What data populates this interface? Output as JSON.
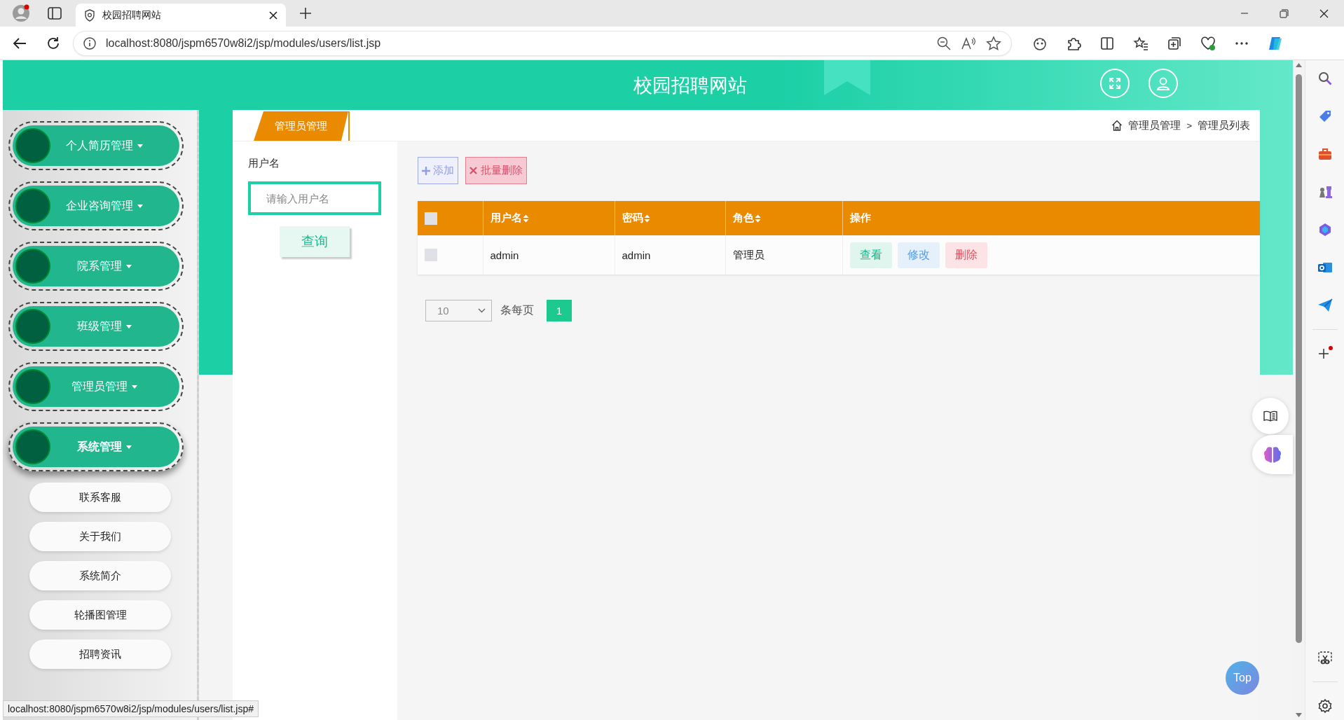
{
  "browser": {
    "tabs": [
      {
        "title": "校园招聘网站",
        "selected": true
      }
    ],
    "url": "localhost:8080/jspm6570w8i2/jsp/modules/users/list.jsp",
    "status_url": "localhost:8080/jspm6570w8i2/jsp/modules/users/list.jsp#"
  },
  "header": {
    "title": "校园招聘网站"
  },
  "sidebar": {
    "menus": [
      {
        "label": "个人简历管理",
        "expanded": false
      },
      {
        "label": "企业咨询管理",
        "expanded": false
      },
      {
        "label": "院系管理",
        "expanded": false
      },
      {
        "label": "班级管理",
        "expanded": false
      },
      {
        "label": "管理员管理",
        "expanded": false
      },
      {
        "label": "系统管理",
        "expanded": true,
        "children": [
          {
            "label": "联系客服"
          },
          {
            "label": "关于我们"
          },
          {
            "label": "系统简介"
          },
          {
            "label": "轮播图管理"
          },
          {
            "label": "招聘资讯"
          }
        ]
      }
    ]
  },
  "content": {
    "tab": {
      "label": "管理员管理"
    },
    "breadcrumb": {
      "items": [
        "管理员管理",
        "管理员列表"
      ],
      "separator": ">"
    },
    "search": {
      "label": "用户名",
      "placeholder": "请输入用户名",
      "button": "查询"
    },
    "toolbar": [
      {
        "label": "添加",
        "kind": "add"
      },
      {
        "label": "批量删除",
        "kind": "delete"
      }
    ],
    "table": {
      "select_all_checked": false,
      "columns": [
        {
          "label": "用户名",
          "sortable": true
        },
        {
          "label": "密码",
          "sortable": true
        },
        {
          "label": "角色",
          "sortable": true
        },
        {
          "label": "操作",
          "sortable": false
        }
      ],
      "rows": [
        {
          "checked": false,
          "cells": [
            "admin",
            "admin",
            "管理员"
          ],
          "actions": [
            {
              "label": "查看",
              "kind": "view"
            },
            {
              "label": "修改",
              "kind": "edit"
            },
            {
              "label": "删除",
              "kind": "delete"
            }
          ]
        }
      ]
    },
    "pagination": {
      "page_size": "10",
      "per_page_label": "条每页",
      "pages": [
        {
          "label": "1",
          "selected": true
        }
      ]
    }
  },
  "top_button": "Top"
}
